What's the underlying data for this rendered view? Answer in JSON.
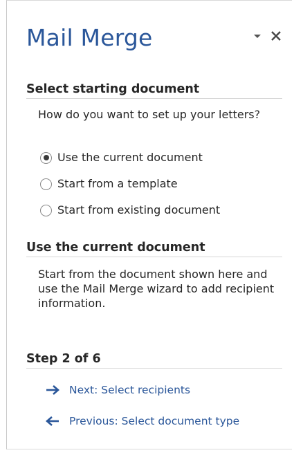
{
  "pane": {
    "title": "Mail Merge",
    "options_icon": "dropdown-triangle-icon",
    "close_icon": "close-icon",
    "accent_color": "#2b579a"
  },
  "select_section": {
    "heading": "Select starting document",
    "question": "How do you want to set up your letters?",
    "options": [
      {
        "label": "Use the current document",
        "selected": true
      },
      {
        "label": "Start from a template",
        "selected": false
      },
      {
        "label": "Start from existing document",
        "selected": false
      }
    ]
  },
  "current_section": {
    "heading": "Use the current document",
    "description": "Start from the document shown here and use the Mail Merge wizard to add recipient information."
  },
  "step": {
    "heading": "Step 2 of 6",
    "next_label": "Next: Select recipients",
    "next_icon": "arrow-right-icon",
    "previous_label": "Previous: Select document type",
    "previous_icon": "arrow-left-icon"
  }
}
